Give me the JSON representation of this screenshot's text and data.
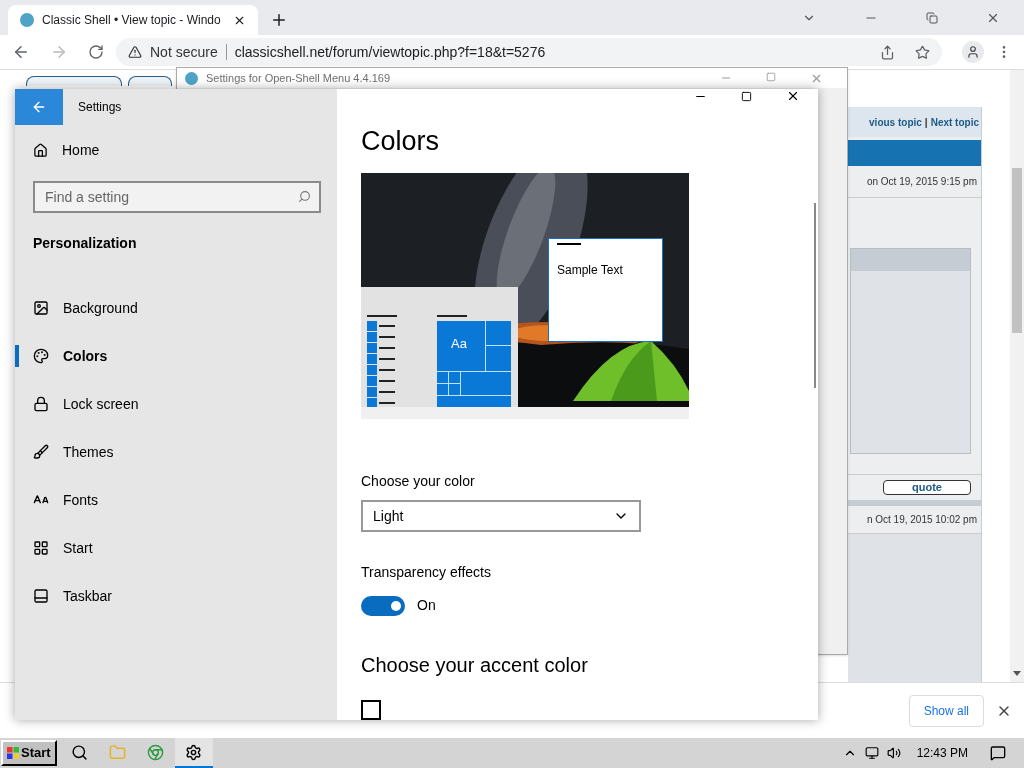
{
  "browser": {
    "tab": {
      "title": "Classic Shell • View topic - Windo"
    },
    "address": {
      "security": "Not secure",
      "url": "classicshell.net/forum/viewtopic.php?f=18&t=5276"
    }
  },
  "forum": {
    "nav": [
      "vious topic",
      "Next topic"
    ],
    "separator": "|",
    "posts": [
      "on Oct 19, 2015 9:15 pm",
      "n Oct 19, 2015 10:02 pm"
    ],
    "quote": "quote"
  },
  "back_window": {
    "title": "Settings for Open-Shell Menu 4.4.169"
  },
  "settings": {
    "title": "Settings",
    "home": "Home",
    "search": {
      "placeholder": "Find a setting"
    },
    "section": "Personalization",
    "nav": [
      {
        "label": "Background",
        "kind": "background",
        "selected": false
      },
      {
        "label": "Colors",
        "kind": "colors",
        "selected": true
      },
      {
        "label": "Lock screen",
        "kind": "lock",
        "selected": false
      },
      {
        "label": "Themes",
        "kind": "themes",
        "selected": false
      },
      {
        "label": "Fonts",
        "kind": "fonts",
        "selected": false
      },
      {
        "label": "Start",
        "kind": "start",
        "selected": false
      },
      {
        "label": "Taskbar",
        "kind": "taskbar",
        "selected": false
      }
    ],
    "page": {
      "heading": "Colors",
      "preview": {
        "tile_text": "Aa",
        "sample_text": "Sample Text"
      },
      "choose_color": {
        "label": "Choose your color",
        "value": "Light"
      },
      "transparency": {
        "label": "Transparency effects",
        "on": true,
        "state_text": "On"
      },
      "accent_heading": "Choose your accent color",
      "auto_pick": {
        "checked": false
      }
    }
  },
  "downloads": {
    "show_all": "Show all"
  },
  "taskbar": {
    "start": "Start",
    "apps": [
      {
        "kind": "search",
        "selected": false
      },
      {
        "kind": "folder",
        "selected": false
      },
      {
        "kind": "browser",
        "selected": false
      },
      {
        "kind": "settings",
        "selected": true
      }
    ],
    "clock": "12:43 PM"
  }
}
